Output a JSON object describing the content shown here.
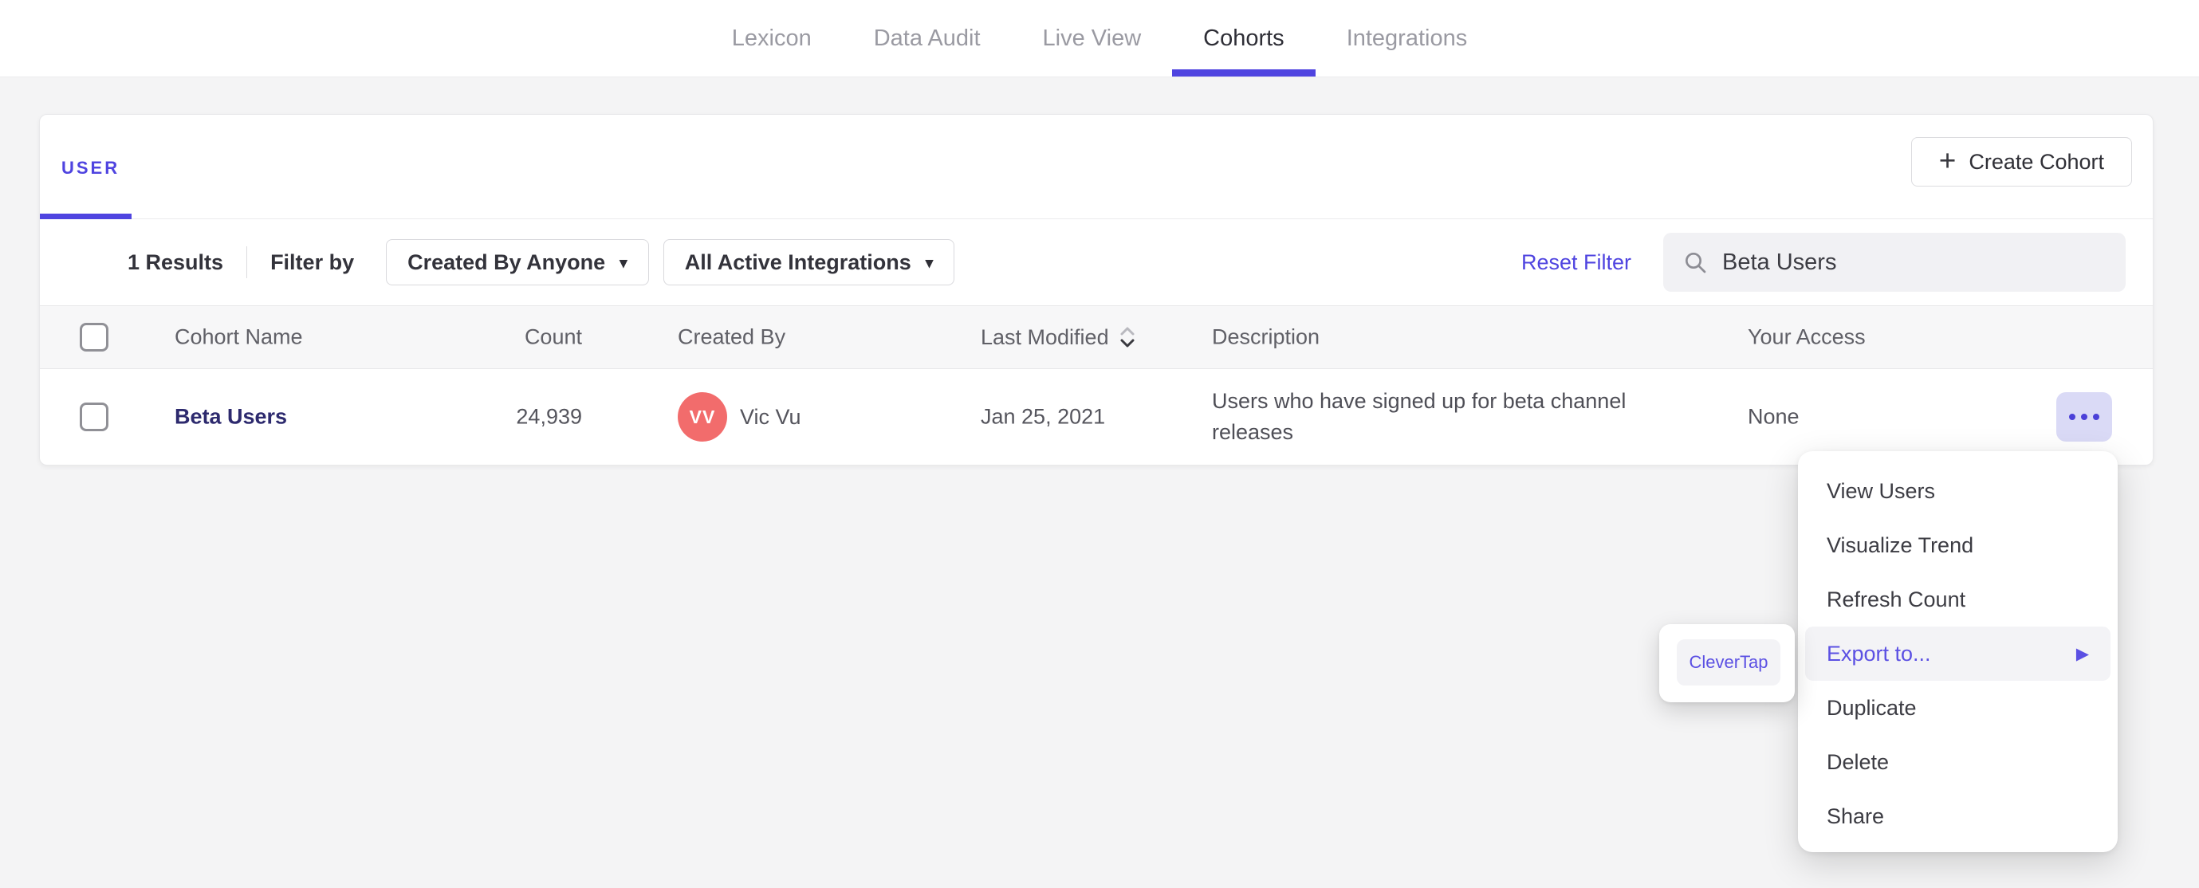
{
  "nav": {
    "tabs": [
      {
        "label": "Lexicon"
      },
      {
        "label": "Data Audit"
      },
      {
        "label": "Live View"
      },
      {
        "label": "Cohorts"
      },
      {
        "label": "Integrations"
      }
    ],
    "active_tab": "Cohorts"
  },
  "panel": {
    "type_tab": "USER",
    "create_cohort_button": "Create Cohort",
    "filters": {
      "results": "1 Results",
      "filter_by": "Filter by",
      "created_by_dropdown": "Created By Anyone",
      "integrations_dropdown": "All Active Integrations",
      "reset_filter": "Reset Filter",
      "search_value": "Beta Users"
    },
    "table": {
      "headers": {
        "cohort_name": "Cohort Name",
        "count": "Count",
        "created_by": "Created By",
        "last_modified": "Last Modified",
        "description": "Description",
        "your_access": "Your Access"
      },
      "rows": [
        {
          "name": "Beta Users",
          "count": "24,939",
          "avatar_initials": "VV",
          "creator": "Vic Vu",
          "last_modified": "Jan 25, 2021",
          "description": "Users who have signed up for beta channel releases",
          "access": "None"
        }
      ]
    }
  },
  "row_menu": {
    "items": [
      "View Users",
      "Visualize Trend",
      "Refresh Count",
      "Export to...",
      "Duplicate",
      "Delete",
      "Share"
    ],
    "highlighted_item": "Export to...",
    "submenu": {
      "items": [
        "CleverTap"
      ]
    }
  },
  "icons": {
    "plus": "+",
    "chevron_down": "▾",
    "arrow_right": "▶"
  },
  "colors": {
    "accent_purple": "#4f44e0",
    "cohort_link": "#2d2a6e",
    "avatar_background": "#f26c6c",
    "menu_highlight_text": "#5b50e3",
    "dots_button_background": "#dadaf6",
    "page_background": "#f4f4f5"
  }
}
